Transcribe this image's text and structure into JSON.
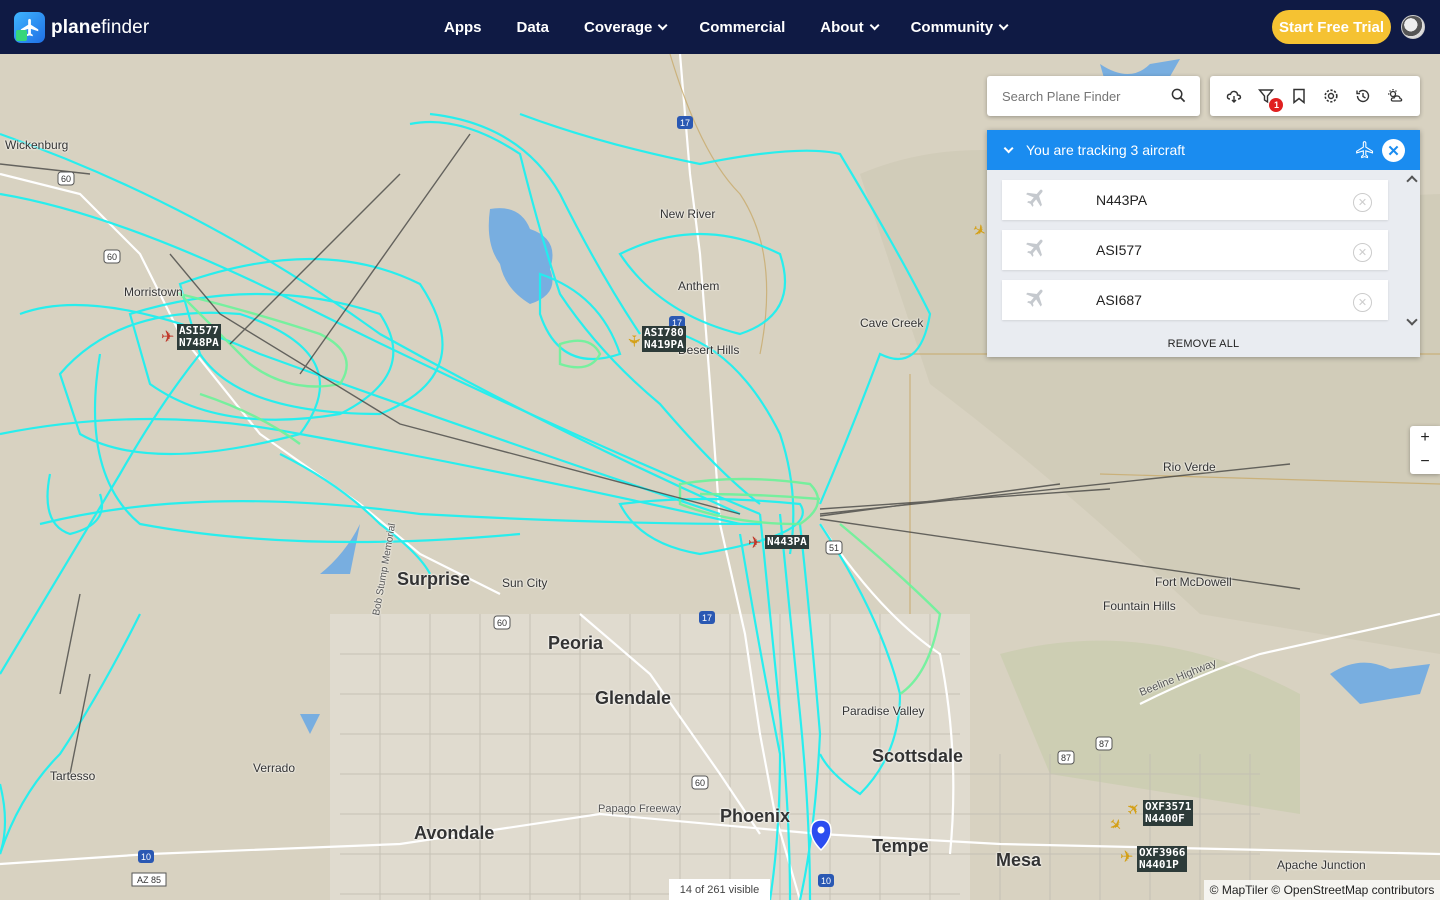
{
  "brand": {
    "name_bold": "plane",
    "name_rest": "finder"
  },
  "nav": [
    {
      "label": "Apps",
      "dropdown": false
    },
    {
      "label": "Data",
      "dropdown": false
    },
    {
      "label": "Coverage",
      "dropdown": true
    },
    {
      "label": "Commercial",
      "dropdown": false
    },
    {
      "label": "About",
      "dropdown": true
    },
    {
      "label": "Community",
      "dropdown": true
    }
  ],
  "cta": {
    "label": "Start Free Trial"
  },
  "search": {
    "placeholder": "Search Plane Finder"
  },
  "toolbar": {
    "icons": [
      "cloud-icon",
      "filter-icon",
      "bookmark-icon",
      "settings-icon",
      "history-icon",
      "weather-icon"
    ],
    "filter_badge": "1"
  },
  "tracking": {
    "title": "You are tracking 3 aircraft",
    "aircraft": [
      "N443PA",
      "ASI577",
      "ASI687"
    ],
    "remove_all": "REMOVE ALL"
  },
  "zoom": {
    "in": "+",
    "out": "−"
  },
  "status": {
    "visible": "14 of 261 visible"
  },
  "attribution": "© MapTiler © OpenStreetMap contributors",
  "map": {
    "places_big": [
      "Surprise",
      "Peoria",
      "Glendale",
      "Phoenix",
      "Scottsdale",
      "Tempe",
      "Mesa",
      "Avondale"
    ],
    "places_small": [
      "Wickenburg",
      "New River",
      "Anthem",
      "Cave Creek",
      "Desert Hills",
      "Morristown",
      "Sun City",
      "Rio Verde",
      "Fort McDowell",
      "Fountain Hills",
      "Paradise Valley",
      "Verrado",
      "Tartesso",
      "Apache Junction",
      "Papago Freeway",
      "Beeline Highway",
      "Bob Stump Memorial"
    ],
    "flights": [
      {
        "line1": "ASI577",
        "line2": "N748PA"
      },
      {
        "line1": "ASI780",
        "line2": "N419PA"
      },
      {
        "line1": "N443PA",
        "line2": ""
      },
      {
        "line1": "OXF3571",
        "line2": "N4400F"
      },
      {
        "line1": "OXF3966",
        "line2": "N4401P"
      }
    ],
    "colors": {
      "track": "#1ff0f0",
      "track_low": "#6cf39a",
      "water": "#78aee0",
      "road": "#ffffff"
    }
  }
}
